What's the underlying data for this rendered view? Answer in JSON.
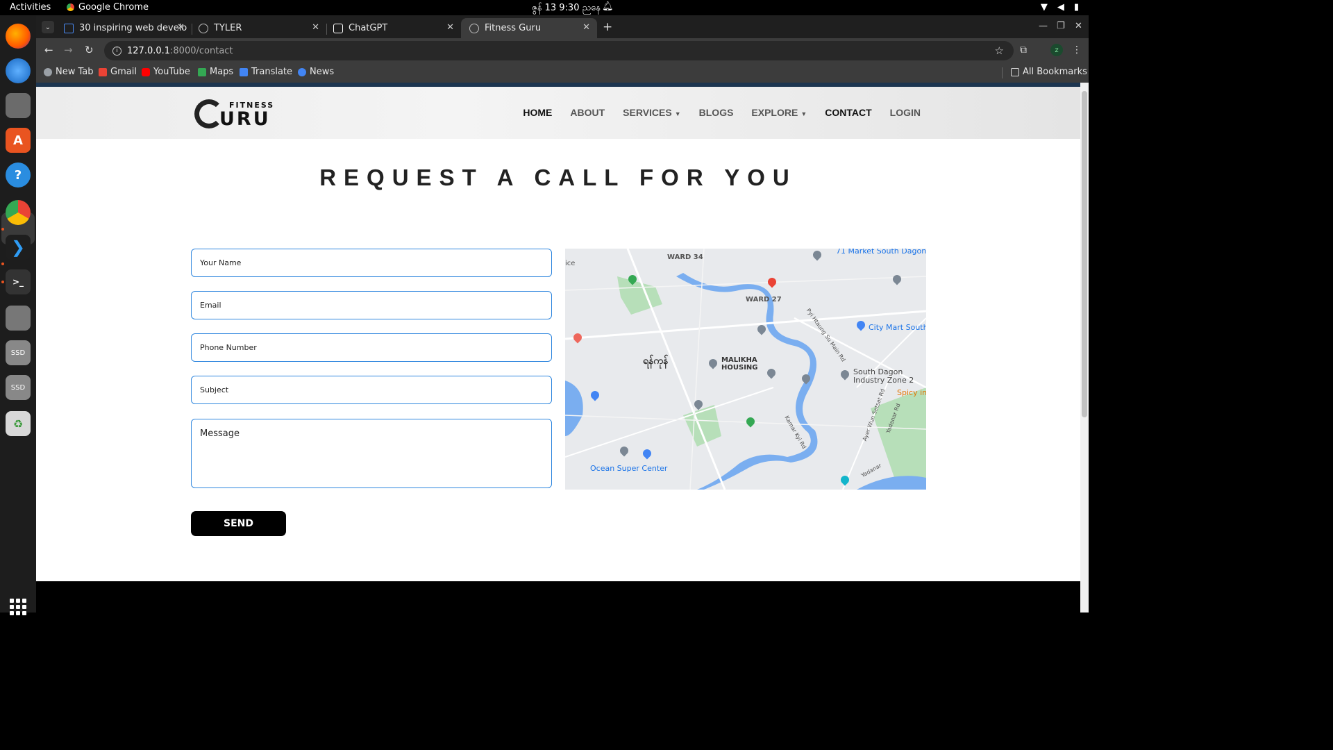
{
  "os": {
    "activities": "Activities",
    "app_name": "Google Chrome",
    "clock": "ဇွန် 13   9:30 ညနေ"
  },
  "browser": {
    "tabs": [
      {
        "title": "30 inspiring web develo",
        "active": false
      },
      {
        "title": "TYLER",
        "active": false
      },
      {
        "title": "ChatGPT",
        "active": false
      },
      {
        "title": "Fitness Guru",
        "active": true
      }
    ],
    "url_host": "127.0.0.1",
    "url_path": ":8000/contact",
    "profile_initial": "z",
    "bookmarks": [
      {
        "label": "New Tab",
        "color": "#9aa0a6"
      },
      {
        "label": "Gmail",
        "color": "#ea4335"
      },
      {
        "label": "YouTube",
        "color": "#ff0000"
      },
      {
        "label": "Maps",
        "color": "#34a853"
      },
      {
        "label": "Translate",
        "color": "#4285f4"
      },
      {
        "label": "News",
        "color": "#4285f4"
      }
    ],
    "all_bookmarks": "All Bookmarks"
  },
  "site": {
    "logo_top": "FITNESS",
    "logo_bottom": "URU",
    "nav": [
      {
        "label": "HOME",
        "has_caret": false
      },
      {
        "label": "ABOUT",
        "has_caret": false
      },
      {
        "label": "SERVICES",
        "has_caret": true
      },
      {
        "label": "BLOGS",
        "has_caret": false
      },
      {
        "label": "EXPLORE",
        "has_caret": true
      },
      {
        "label": "CONTACT",
        "has_caret": false
      },
      {
        "label": "LOGIN",
        "has_caret": false
      }
    ]
  },
  "contact": {
    "heading": "REQUEST A CALL FOR YOU",
    "name_placeholder": "Your Name",
    "email_placeholder": "Email",
    "phone_placeholder": "Phone Number",
    "subject_placeholder": "Subject",
    "message_placeholder": "Message",
    "send_label": "SEND"
  },
  "map": {
    "labels": {
      "market": "71 Market South Dagon",
      "ward34": "WARD 34",
      "ward27": "WARD 27",
      "malikha": "MALIKHA HOUSING",
      "city_mart": "City Mart South D",
      "south_dagon": "South Dagon Industry Zone 2",
      "spicy": "Spicy in",
      "ocean": "Ocean Super Center",
      "yangon_my": "ရန်ကုန်",
      "ice": "ice",
      "pyi_htaung": "Pyi Htaung Su Main Rd",
      "kamar": "Kamar Kyi Rd",
      "ayer_wun": "Ayer Wun Setsat Rd",
      "yadanar_rd": "Yadanar Rd",
      "yadanar": "Yadanar"
    },
    "colors": {
      "land": "#e8eaed",
      "water": "#7aaef0",
      "park": "#b7dfb9",
      "road": "#ffffff"
    }
  }
}
